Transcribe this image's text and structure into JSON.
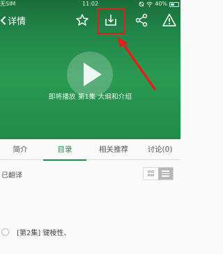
{
  "status_bar": {
    "carrier": "无SIM",
    "time": "11:02",
    "battery": "40%"
  },
  "nav": {
    "back_label": "详情",
    "icons": [
      "star-icon",
      "download-icon",
      "share-icon",
      "warning-icon"
    ]
  },
  "player": {
    "caption": "即将播放 第1集 大纲和介绍"
  },
  "tabs": [
    {
      "label": "简介"
    },
    {
      "label": "目录",
      "active": true
    },
    {
      "label": "相关推荐"
    },
    {
      "label": "讨论(0)"
    }
  ],
  "catalog": {
    "status_label": "已翻译",
    "episodes": [
      {
        "title": "[第2集] 键棱性、 "
      }
    ]
  },
  "colors": {
    "accent_green": "#1e8a44",
    "annotation_red": "#e0201b"
  }
}
